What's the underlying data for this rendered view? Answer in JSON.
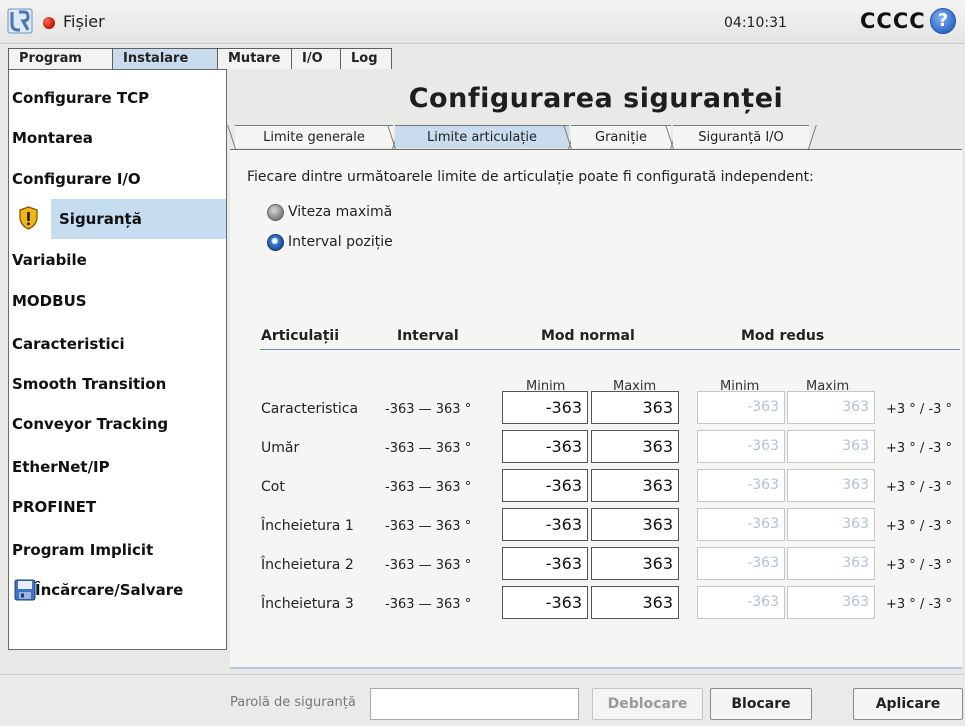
{
  "topbar": {
    "file_menu": "Fișier",
    "clock": "04:10:31",
    "robot_name": "CCCC",
    "help": "?",
    "status_color": "#d40f00"
  },
  "main_tabs": [
    "Program",
    "Instalare",
    "Mutare",
    "I/O",
    "Log"
  ],
  "active_main_tab": "Instalare",
  "sidebar": {
    "items": [
      "Configurare TCP",
      "Montarea",
      "Configurare I/O",
      "Siguranță",
      "Variabile",
      "MODBUS",
      "Caracteristici",
      "Smooth Transition",
      "Conveyor Tracking",
      "EtherNet/IP",
      "PROFINET",
      "Program Implicit",
      "Încărcare/Salvare"
    ],
    "active_item": "Siguranță"
  },
  "page": {
    "title": "Configurarea siguranței",
    "sub_tabs": [
      "Limite generale",
      "Limite articulație",
      "Graniție",
      "Siguranță I/O"
    ],
    "active_sub_tab": "Limite articulație",
    "intro": "Fiecare dintre următoarele limite de articulație poate fi configurată independent:",
    "radio_options": [
      {
        "label": "Viteza maximă",
        "selected": false
      },
      {
        "label": "Interval poziție",
        "selected": true
      }
    ],
    "columns": {
      "joints": "Articulații",
      "interval": "Interval",
      "normal_mode": "Mod normal",
      "reduced_mode": "Mod redus",
      "min": "Minim",
      "max": "Maxim"
    },
    "joints": [
      {
        "name": "Caracteristica",
        "range": "-363 — 363 °",
        "normal_min": "-363",
        "normal_max": "363",
        "reduced_min": "-363",
        "reduced_max": "363",
        "tolerance": "+3 ° / -3 °"
      },
      {
        "name": "Umăr",
        "range": "-363 — 363 °",
        "normal_min": "-363",
        "normal_max": "363",
        "reduced_min": "-363",
        "reduced_max": "363",
        "tolerance": "+3 ° / -3 °"
      },
      {
        "name": "Cot",
        "range": "-363 — 363 °",
        "normal_min": "-363",
        "normal_max": "363",
        "reduced_min": "-363",
        "reduced_max": "363",
        "tolerance": "+3 ° / -3 °"
      },
      {
        "name": "Încheietura 1",
        "range": "-363 — 363 °",
        "normal_min": "-363",
        "normal_max": "363",
        "reduced_min": "-363",
        "reduced_max": "363",
        "tolerance": "+3 ° / -3 °"
      },
      {
        "name": "Încheietura 2",
        "range": "-363 — 363 °",
        "normal_min": "-363",
        "normal_max": "363",
        "reduced_min": "-363",
        "reduced_max": "363",
        "tolerance": "+3 ° / -3 °"
      },
      {
        "name": "Încheietura 3",
        "range": "-363 — 363 °",
        "normal_min": "-363",
        "normal_max": "363",
        "reduced_min": "-363",
        "reduced_max": "363",
        "tolerance": "+3 ° / -3 °"
      }
    ]
  },
  "bottom": {
    "password_label": "Parolă de siguranță",
    "password_value": "",
    "unlock_label": "Deblocare",
    "lock_label": "Blocare",
    "apply_label": "Aplicare"
  }
}
